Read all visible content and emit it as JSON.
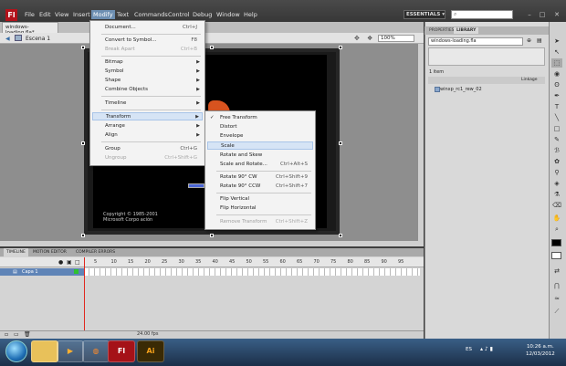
{
  "app": {
    "logo": "Fl"
  },
  "menubar": [
    "File",
    "Edit",
    "View",
    "Insert",
    "Modify",
    "Text",
    "Commands",
    "Control",
    "Debug",
    "Window",
    "Help"
  ],
  "workspace": "ESSENTIALS ▾",
  "document": {
    "tab": "windows-loading.fla*",
    "scene": "Escena 1",
    "zoom": "100%"
  },
  "stage": {
    "copyright_line1": "Copyright © 1985-2001",
    "copyright_line2": "Microsoft Corpo ación"
  },
  "modify_menu": {
    "items": [
      {
        "label": "Document...",
        "shortcut": "Ctrl+J"
      },
      {
        "label": "Convert to Symbol...",
        "shortcut": "F8"
      },
      {
        "label": "Break Apart",
        "shortcut": "Ctrl+B"
      },
      {
        "label": "Bitmap"
      },
      {
        "label": "Symbol"
      },
      {
        "label": "Shape"
      },
      {
        "label": "Combine Objects"
      },
      {
        "label": "Timeline"
      },
      {
        "label": "Transform"
      },
      {
        "label": "Arrange"
      },
      {
        "label": "Align"
      },
      {
        "label": "Group",
        "shortcut": "Ctrl+G"
      },
      {
        "label": "Ungroup",
        "shortcut": "Ctrl+Shift+G"
      }
    ]
  },
  "transform_menu": {
    "items": [
      {
        "label": "Free Transform"
      },
      {
        "label": "Distort"
      },
      {
        "label": "Envelope"
      },
      {
        "label": "Scale"
      },
      {
        "label": "Rotate and Skew"
      },
      {
        "label": "Scale and Rotate...",
        "shortcut": "Ctrl+Alt+S"
      },
      {
        "label": "Rotate 90° CW",
        "shortcut": "Ctrl+Shift+9"
      },
      {
        "label": "Rotate 90° CCW",
        "shortcut": "Ctrl+Shift+7"
      },
      {
        "label": "Flip Vertical"
      },
      {
        "label": "Flip Horizontal"
      },
      {
        "label": "Remove Transform",
        "shortcut": "Ctrl+Shift+Z"
      }
    ]
  },
  "timeline": {
    "tabs": [
      "TIMELINE",
      "MOTION EDITOR",
      "COMPILER ERRORS"
    ],
    "frame_numbers": [
      "5",
      "10",
      "15",
      "20",
      "25",
      "30",
      "35",
      "40",
      "45",
      "50",
      "55",
      "60",
      "65",
      "70",
      "75",
      "80",
      "85",
      "90",
      "95"
    ],
    "layer": "Capa 1",
    "fps": "24.00 fps"
  },
  "library": {
    "tabs": [
      "PROPERTIES",
      "LIBRARY"
    ],
    "file": "windows-loading.fla",
    "count": "1 item",
    "col_linkage": "Linkage",
    "item": "winxp_rc1_rew_02"
  },
  "taskbar": {
    "flash": "Fl",
    "illustrator": "Ai",
    "lang": "ES",
    "time": "10:26 a.m.",
    "date": "12/03/2012"
  },
  "colors": {
    "accent": "#6d8fb2",
    "highlight": "#d6e4f5",
    "layer": "#5f84b7",
    "flash_red": "#b3121b"
  }
}
